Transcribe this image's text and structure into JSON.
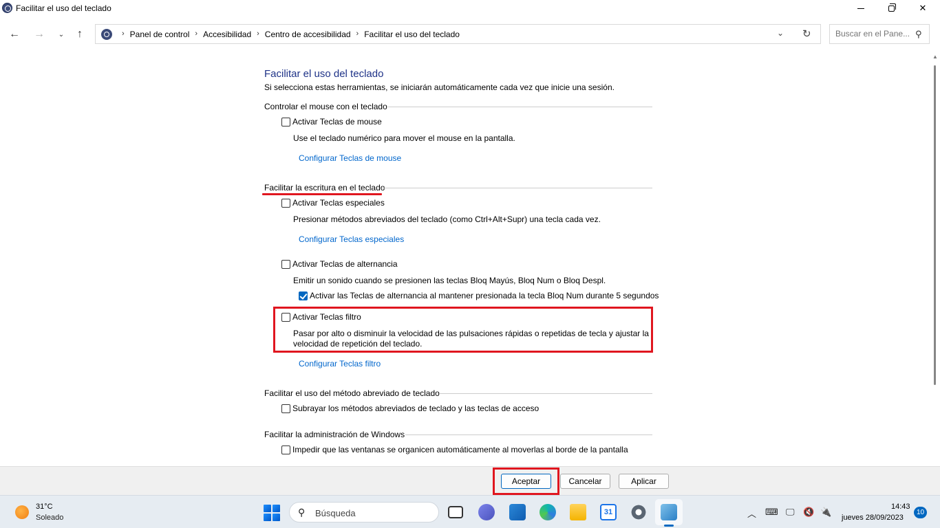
{
  "window": {
    "title": "Facilitar el uso del teclado"
  },
  "nav": {
    "breadcrumbs": [
      "Panel de control",
      "Accesibilidad",
      "Centro de accesibilidad",
      "Facilitar el uso del teclado"
    ],
    "search_placeholder": "Buscar en el Pane..."
  },
  "page": {
    "title": "Facilitar el uso del teclado",
    "subtitle": "Si selecciona estas herramientas, se iniciarán automáticamente cada vez que inicie una sesión."
  },
  "sections": {
    "mouse": {
      "heading": "Controlar el mouse con el teclado",
      "checkbox_label": "Activar Teclas de mouse",
      "checked": false,
      "description": "Use el teclado numérico para mover el mouse en la pantalla.",
      "link": "Configurar Teclas de mouse"
    },
    "typing": {
      "heading": "Facilitar la escritura en el teclado",
      "sticky": {
        "checkbox_label": "Activar Teclas especiales",
        "checked": false,
        "description": "Presionar métodos abreviados del teclado (como Ctrl+Alt+Supr) una tecla cada vez.",
        "link": "Configurar Teclas especiales"
      },
      "toggle": {
        "checkbox_label": "Activar Teclas de alternancia",
        "checked": false,
        "description": "Emitir un sonido cuando se presionen las teclas Bloq Mayús, Bloq Num o Bloq Despl.",
        "sub_checkbox_label": "Activar las Teclas de alternancia al mantener presionada la tecla Bloq Num durante 5 segundos",
        "sub_checked": true
      },
      "filter": {
        "checkbox_label": "Activar Teclas filtro",
        "checked": false,
        "description_line1": "Pasar por alto o disminuir la velocidad de las pulsaciones rápidas o repetidas de tecla y ajustar la",
        "description_line2": "velocidad de repetición del teclado.",
        "link": "Configurar Teclas filtro"
      }
    },
    "shortcuts": {
      "heading": "Facilitar el uso del método abreviado de teclado",
      "checkbox_label": "Subrayar los métodos abreviados de teclado y las teclas de acceso",
      "checked": false
    },
    "windows": {
      "heading": "Facilitar la administración de Windows",
      "checkbox_label": "Impedir que las ventanas se organicen automáticamente al moverlas al borde de la pantalla",
      "checked": false
    }
  },
  "buttons": {
    "ok": "Aceptar",
    "cancel": "Cancelar",
    "apply": "Aplicar"
  },
  "taskbar": {
    "weather_temp": "31°C",
    "weather_desc": "Soleado",
    "search_label": "Búsqueda",
    "calendar_day": "31",
    "time": "14:43",
    "date": "jueves 28/09/2023",
    "notifications": "10"
  },
  "colors": {
    "link": "#0066cc",
    "title": "#1e3287",
    "highlight": "#e0161f",
    "accent": "#0067c0"
  }
}
